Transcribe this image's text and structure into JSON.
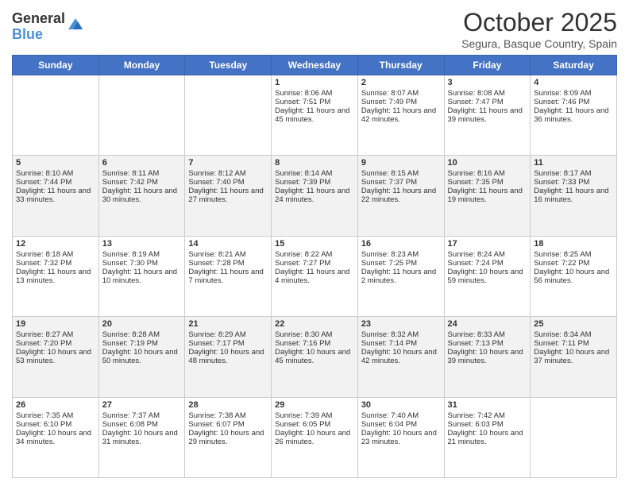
{
  "header": {
    "logo_general": "General",
    "logo_blue": "Blue",
    "month_title": "October 2025",
    "subtitle": "Segura, Basque Country, Spain"
  },
  "days_of_week": [
    "Sunday",
    "Monday",
    "Tuesday",
    "Wednesday",
    "Thursday",
    "Friday",
    "Saturday"
  ],
  "weeks": [
    {
      "row_class": "row-odd",
      "days": [
        {
          "num": "",
          "info": ""
        },
        {
          "num": "",
          "info": ""
        },
        {
          "num": "",
          "info": ""
        },
        {
          "num": "1",
          "info": "Sunrise: 8:06 AM\nSunset: 7:51 PM\nDaylight: 11 hours and 45 minutes."
        },
        {
          "num": "2",
          "info": "Sunrise: 8:07 AM\nSunset: 7:49 PM\nDaylight: 11 hours and 42 minutes."
        },
        {
          "num": "3",
          "info": "Sunrise: 8:08 AM\nSunset: 7:47 PM\nDaylight: 11 hours and 39 minutes."
        },
        {
          "num": "4",
          "info": "Sunrise: 8:09 AM\nSunset: 7:46 PM\nDaylight: 11 hours and 36 minutes."
        }
      ]
    },
    {
      "row_class": "row-even",
      "days": [
        {
          "num": "5",
          "info": "Sunrise: 8:10 AM\nSunset: 7:44 PM\nDaylight: 11 hours and 33 minutes."
        },
        {
          "num": "6",
          "info": "Sunrise: 8:11 AM\nSunset: 7:42 PM\nDaylight: 11 hours and 30 minutes."
        },
        {
          "num": "7",
          "info": "Sunrise: 8:12 AM\nSunset: 7:40 PM\nDaylight: 11 hours and 27 minutes."
        },
        {
          "num": "8",
          "info": "Sunrise: 8:14 AM\nSunset: 7:39 PM\nDaylight: 11 hours and 24 minutes."
        },
        {
          "num": "9",
          "info": "Sunrise: 8:15 AM\nSunset: 7:37 PM\nDaylight: 11 hours and 22 minutes."
        },
        {
          "num": "10",
          "info": "Sunrise: 8:16 AM\nSunset: 7:35 PM\nDaylight: 11 hours and 19 minutes."
        },
        {
          "num": "11",
          "info": "Sunrise: 8:17 AM\nSunset: 7:33 PM\nDaylight: 11 hours and 16 minutes."
        }
      ]
    },
    {
      "row_class": "row-odd",
      "days": [
        {
          "num": "12",
          "info": "Sunrise: 8:18 AM\nSunset: 7:32 PM\nDaylight: 11 hours and 13 minutes."
        },
        {
          "num": "13",
          "info": "Sunrise: 8:19 AM\nSunset: 7:30 PM\nDaylight: 11 hours and 10 minutes."
        },
        {
          "num": "14",
          "info": "Sunrise: 8:21 AM\nSunset: 7:28 PM\nDaylight: 11 hours and 7 minutes."
        },
        {
          "num": "15",
          "info": "Sunrise: 8:22 AM\nSunset: 7:27 PM\nDaylight: 11 hours and 4 minutes."
        },
        {
          "num": "16",
          "info": "Sunrise: 8:23 AM\nSunset: 7:25 PM\nDaylight: 11 hours and 2 minutes."
        },
        {
          "num": "17",
          "info": "Sunrise: 8:24 AM\nSunset: 7:24 PM\nDaylight: 10 hours and 59 minutes."
        },
        {
          "num": "18",
          "info": "Sunrise: 8:25 AM\nSunset: 7:22 PM\nDaylight: 10 hours and 56 minutes."
        }
      ]
    },
    {
      "row_class": "row-even",
      "days": [
        {
          "num": "19",
          "info": "Sunrise: 8:27 AM\nSunset: 7:20 PM\nDaylight: 10 hours and 53 minutes."
        },
        {
          "num": "20",
          "info": "Sunrise: 8:28 AM\nSunset: 7:19 PM\nDaylight: 10 hours and 50 minutes."
        },
        {
          "num": "21",
          "info": "Sunrise: 8:29 AM\nSunset: 7:17 PM\nDaylight: 10 hours and 48 minutes."
        },
        {
          "num": "22",
          "info": "Sunrise: 8:30 AM\nSunset: 7:16 PM\nDaylight: 10 hours and 45 minutes."
        },
        {
          "num": "23",
          "info": "Sunrise: 8:32 AM\nSunset: 7:14 PM\nDaylight: 10 hours and 42 minutes."
        },
        {
          "num": "24",
          "info": "Sunrise: 8:33 AM\nSunset: 7:13 PM\nDaylight: 10 hours and 39 minutes."
        },
        {
          "num": "25",
          "info": "Sunrise: 8:34 AM\nSunset: 7:11 PM\nDaylight: 10 hours and 37 minutes."
        }
      ]
    },
    {
      "row_class": "row-odd",
      "days": [
        {
          "num": "26",
          "info": "Sunrise: 7:35 AM\nSunset: 6:10 PM\nDaylight: 10 hours and 34 minutes."
        },
        {
          "num": "27",
          "info": "Sunrise: 7:37 AM\nSunset: 6:08 PM\nDaylight: 10 hours and 31 minutes."
        },
        {
          "num": "28",
          "info": "Sunrise: 7:38 AM\nSunset: 6:07 PM\nDaylight: 10 hours and 29 minutes."
        },
        {
          "num": "29",
          "info": "Sunrise: 7:39 AM\nSunset: 6:05 PM\nDaylight: 10 hours and 26 minutes."
        },
        {
          "num": "30",
          "info": "Sunrise: 7:40 AM\nSunset: 6:04 PM\nDaylight: 10 hours and 23 minutes."
        },
        {
          "num": "31",
          "info": "Sunrise: 7:42 AM\nSunset: 6:03 PM\nDaylight: 10 hours and 21 minutes."
        },
        {
          "num": "",
          "info": ""
        }
      ]
    }
  ]
}
